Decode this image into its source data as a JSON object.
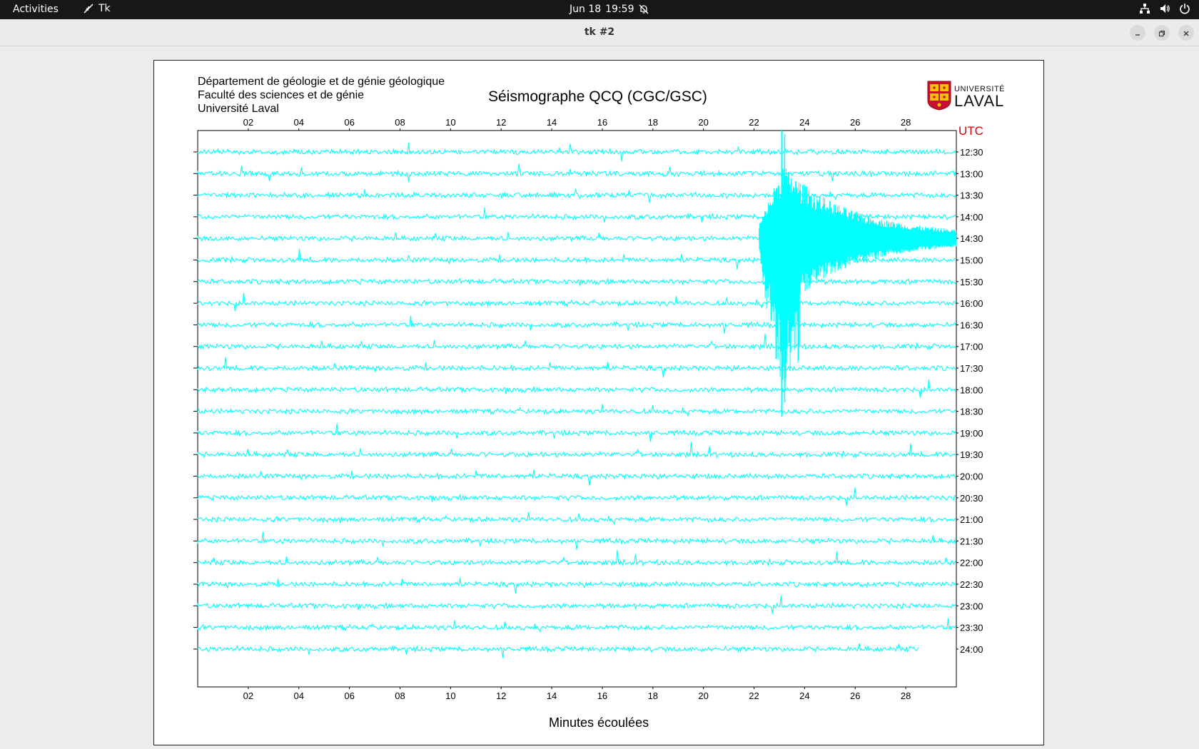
{
  "topbar": {
    "activities": "Activities",
    "app_name": "Tk",
    "date": "Jun 18",
    "time": "19:59"
  },
  "window": {
    "title": "tk #2"
  },
  "header": {
    "dept_line1": "Département de géologie et de génie géologique",
    "dept_line2": "Faculté des sciences et de génie",
    "dept_line3": "Université Laval",
    "title": "Séismographe QCQ (CGC/GSC)",
    "logo_line1": "UNIVERSITÉ",
    "logo_line2": "LAVAL"
  },
  "chart_data": {
    "type": "line",
    "title": "Séismographe QCQ (CGC/GSC)",
    "xlabel": "Minutes écoulées",
    "ylabel": "UTC",
    "xlim": [
      0,
      30
    ],
    "x_ticks": [
      "02",
      "04",
      "06",
      "08",
      "10",
      "12",
      "14",
      "16",
      "18",
      "20",
      "22",
      "24",
      "26",
      "28"
    ],
    "row_labels": [
      "12:30",
      "13:00",
      "13:30",
      "14:00",
      "14:30",
      "15:00",
      "15:30",
      "16:00",
      "16:30",
      "17:00",
      "17:30",
      "18:00",
      "18:30",
      "19:00",
      "19:30",
      "20:00",
      "20:30",
      "21:00",
      "21:30",
      "22:00",
      "22:30",
      "23:00",
      "23:30",
      "24:00"
    ],
    "trace_color": "#00ffff",
    "event": {
      "row": "14:30",
      "onset_minute": 22.2,
      "peak_minute": 23.1,
      "description_visible": false
    },
    "last_row_end_minute": 28.5,
    "grid": false
  },
  "colors": {
    "utc_label": "#e00000",
    "trace": "#00ffff",
    "axis": "#000000"
  }
}
